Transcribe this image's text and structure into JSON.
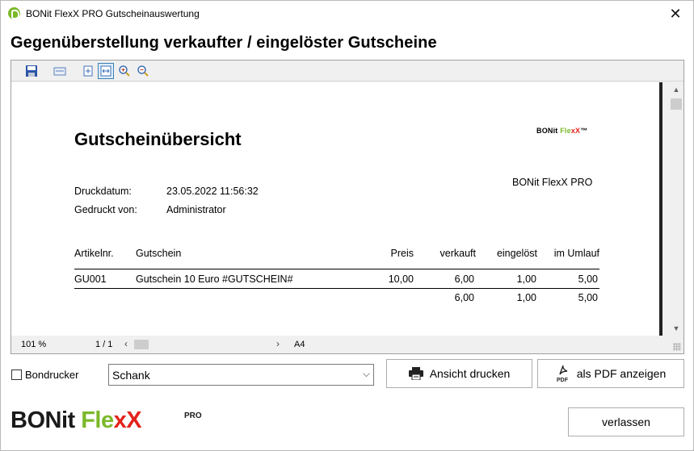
{
  "window": {
    "title": "BONit FlexX PRO Gutscheinauswertung",
    "close_glyph": "✕"
  },
  "heading": "Gegenüberstellung verkaufter / eingelöster Gutscheine",
  "toolbar": {
    "icons": [
      "save-icon",
      "export-icon",
      "fit-page-icon",
      "fit-width-icon",
      "zoom-in-icon",
      "zoom-out-icon"
    ]
  },
  "report": {
    "title": "Gutscheinübersicht",
    "logo": {
      "part1": "BONit ",
      "part2": "Fle",
      "part3": "xX",
      "tm": "™"
    },
    "company": "BONit FlexX PRO",
    "print_date_label": "Druckdatum:",
    "print_date_value": "23.05.2022   11:56:32",
    "printed_by_label": "Gedruckt  von:",
    "printed_by_value": "Administrator",
    "columns": {
      "article": "Artikelnr.",
      "voucher": "Gutschein",
      "price": "Preis",
      "sold": "verkauft",
      "redeemed": "eingelöst",
      "circulation": "im Umlauf"
    },
    "rows": [
      {
        "article": "GU001",
        "voucher": "Gutschein  10  Euro  #GUTSCHEIN#",
        "price": "10,00",
        "sold": "6,00",
        "redeemed": "1,00",
        "circulation": "5,00"
      }
    ],
    "totals": {
      "sold": "6,00",
      "redeemed": "1,00",
      "circulation": "5,00"
    }
  },
  "status": {
    "zoom": "101 %",
    "page": "1 / 1",
    "paper": "A4"
  },
  "controls": {
    "receipt_printer_label": "Bondrucker",
    "receipt_printer_checked": false,
    "printer_select_value": "Schank",
    "print_view_label": "Ansicht drucken",
    "pdf_label": "als PDF anzeigen",
    "exit_label": "verlassen"
  },
  "brand": {
    "part1": "BONit ",
    "part2": "Fle",
    "part3": "xX",
    "pro": "PRO"
  },
  "colors": {
    "brand_green": "#7bb929",
    "brand_red": "#e2231a",
    "accent_blue": "#3c7fb1"
  }
}
